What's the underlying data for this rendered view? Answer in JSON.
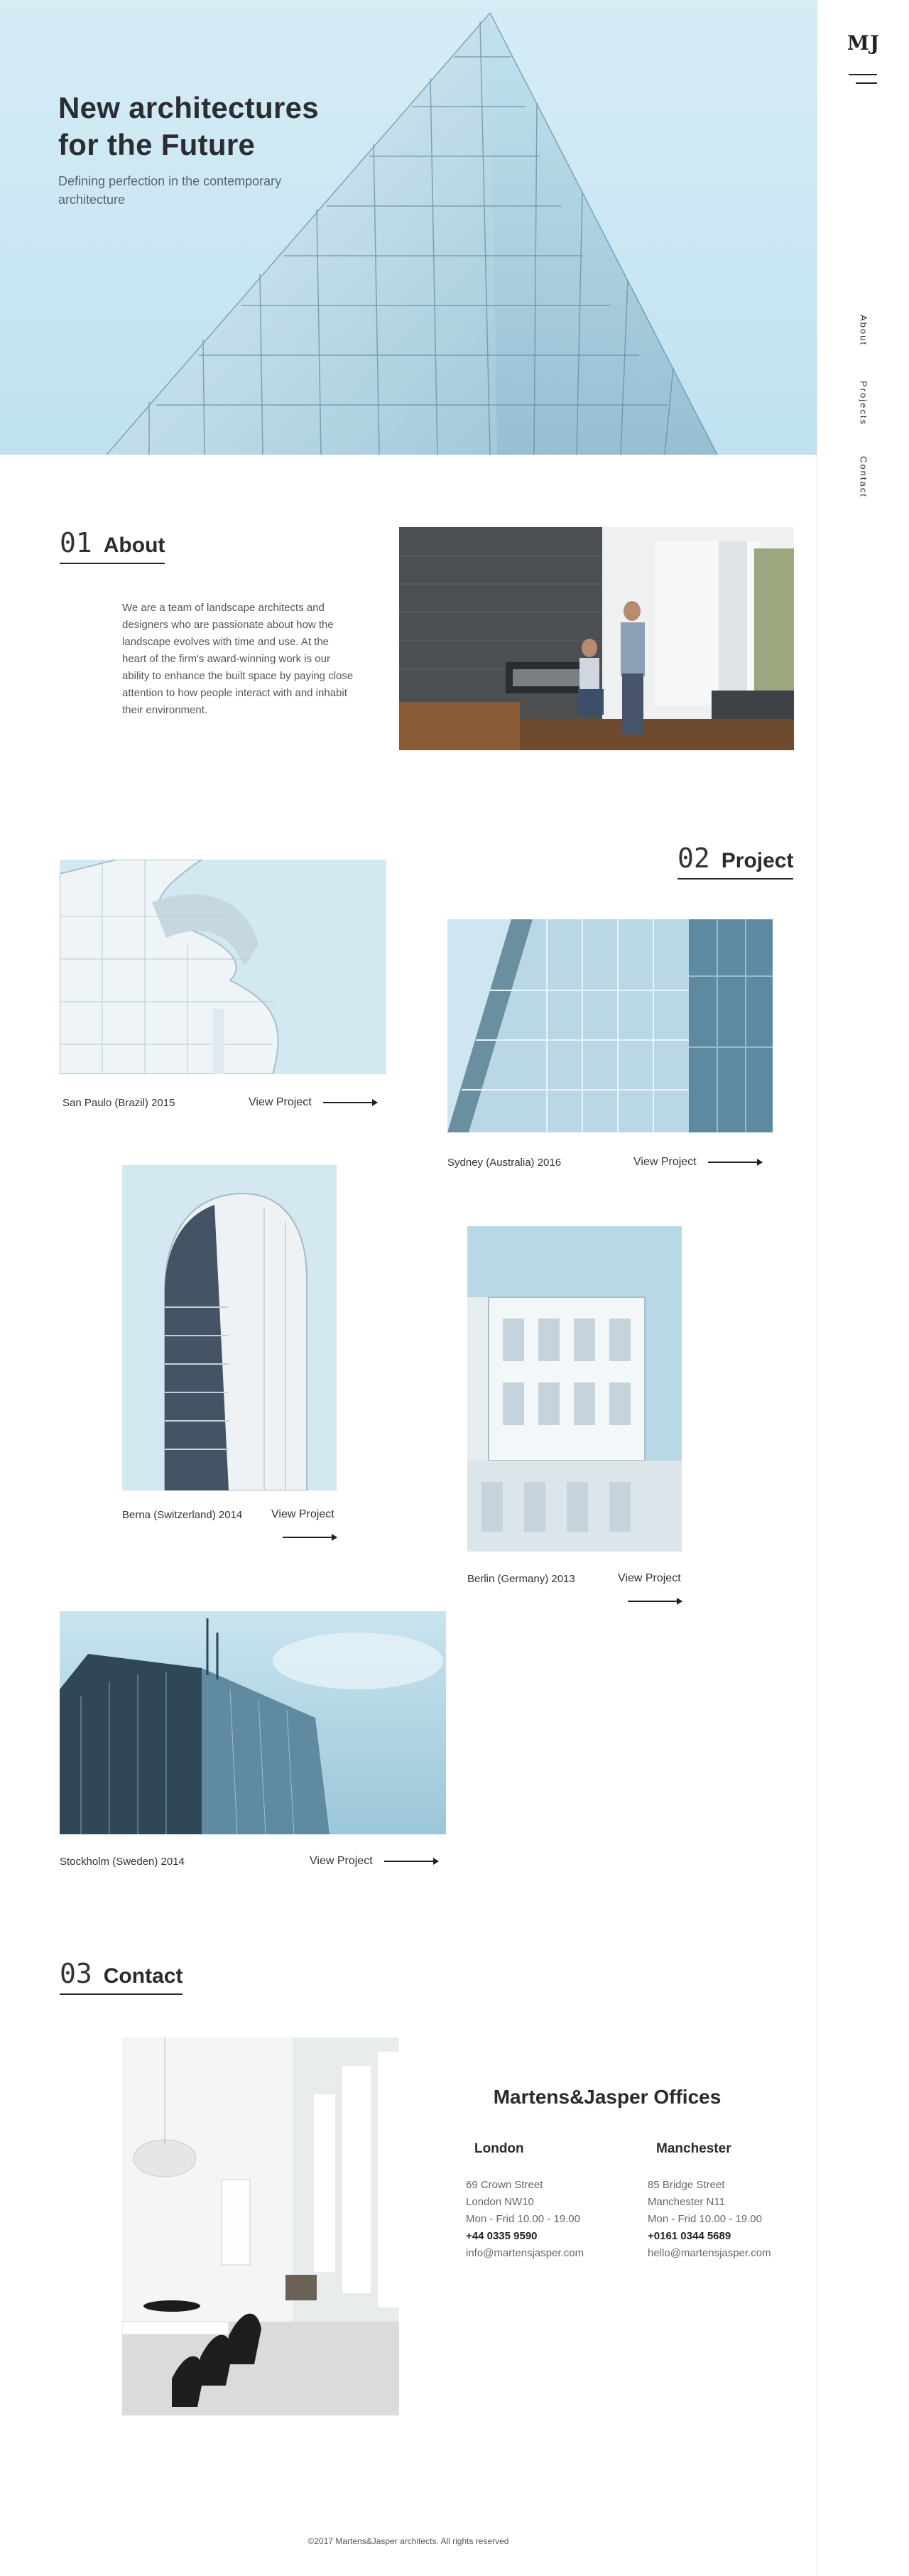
{
  "brand": {
    "logo": "MJ"
  },
  "nav": {
    "items": [
      "About",
      "Projects",
      "Contact"
    ]
  },
  "hero": {
    "title_line1": "New architectures",
    "title_line2": "for the Future",
    "subtitle": "Defining perfection in the contemporary architecture"
  },
  "about": {
    "number": "01",
    "label": "About",
    "text": "We are a team of landscape architects and designers who are passionate about how the landscape evolves with time and use. At the heart of the firm's award-winning work is our ability to enhance the built space by paying close attention to how people interact with and inhabit their environment."
  },
  "projects": {
    "number": "02",
    "label": "Project",
    "view_label": "View Project",
    "items": [
      {
        "caption": "San Paulo (Brazil) 2015"
      },
      {
        "caption": "Sydney (Australia) 2016"
      },
      {
        "caption": "Berna (Switzerland) 2014"
      },
      {
        "caption": "Berlin (Germany) 2013"
      },
      {
        "caption": "Stockholm (Sweden) 2014"
      }
    ]
  },
  "contact": {
    "number": "03",
    "label": "Contact",
    "offices_title": "Martens&Jasper Offices",
    "offices": [
      {
        "city": "London",
        "street": "69 Crown Street",
        "postcode": "London NW10",
        "hours": "Mon - Frid 10.00 - 19.00",
        "phone": "+44 0335 9590",
        "email": "info@martensjasper.com"
      },
      {
        "city": "Manchester",
        "street": "85 Bridge Street",
        "postcode": "Manchester N11",
        "hours": "Mon - Frid 10.00 - 19.00",
        "phone": "+0161 0344 5689",
        "email": "hello@martensjasper.com"
      }
    ]
  },
  "footer": {
    "text": "©2017 Martens&Jasper architects. All rights reserved"
  },
  "colors": {
    "accent": "#2b2b2b",
    "sky": "#cfe8f4",
    "glass": "#7fa9bd"
  }
}
